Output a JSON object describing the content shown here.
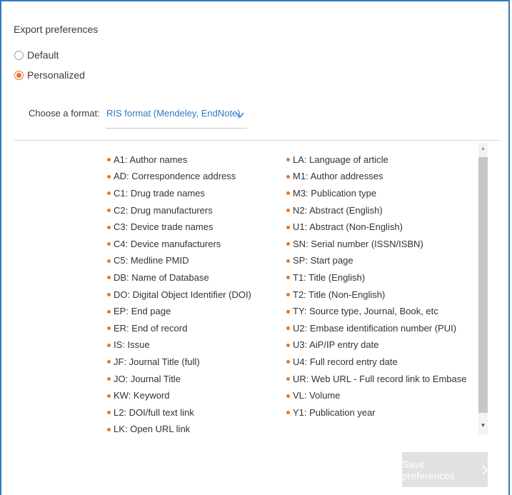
{
  "export_preferences": {
    "title": "Export preferences",
    "options": [
      {
        "label": "Default",
        "selected": false
      },
      {
        "label": "Personalized",
        "selected": true
      }
    ]
  },
  "format": {
    "label": "Choose a format:",
    "selected": "RIS format (Mendeley, EndNote)"
  },
  "fields_left": [
    "A1: Author names",
    "AD: Correspondence address",
    "C1: Drug trade names",
    "C2: Drug manufacturers",
    "C3: Device trade names",
    "C4: Device manufacturers",
    "C5: Medline PMID",
    "DB: Name of Database",
    "DO: Digital Object Identifier (DOI)",
    "EP: End page",
    "ER: End of record",
    "IS: Issue",
    "JF: Journal Title (full)",
    "JO: Journal Title",
    "KW: Keyword",
    "L2: DOI/full text link",
    "LK: Open URL link"
  ],
  "fields_right": [
    "LA: Language of article",
    "M1: Author addresses",
    "M3: Publication type",
    "N2: Abstract (English)",
    "U1: Abstract (Non-English)",
    "SN: Serial number (ISSN/ISBN)",
    "SP: Start page",
    "T1: Title (English)",
    "T2: Title (Non-English)",
    "TY: Source type, Journal, Book, etc",
    "U2: Embase identification number (PUI)",
    "U3: AiP/IP entry date",
    "U4: Full record entry date",
    "UR: Web URL - Full record link to Embase",
    "VL: Volume",
    "Y1: Publication year"
  ],
  "save_button": {
    "label": "Save preferences",
    "icon": "chevron-right-icon"
  },
  "colors": {
    "accent": "#e87722",
    "link": "#2e7ac0",
    "border": "#2e7ac0",
    "button_disabled": "#e1e1e1"
  }
}
